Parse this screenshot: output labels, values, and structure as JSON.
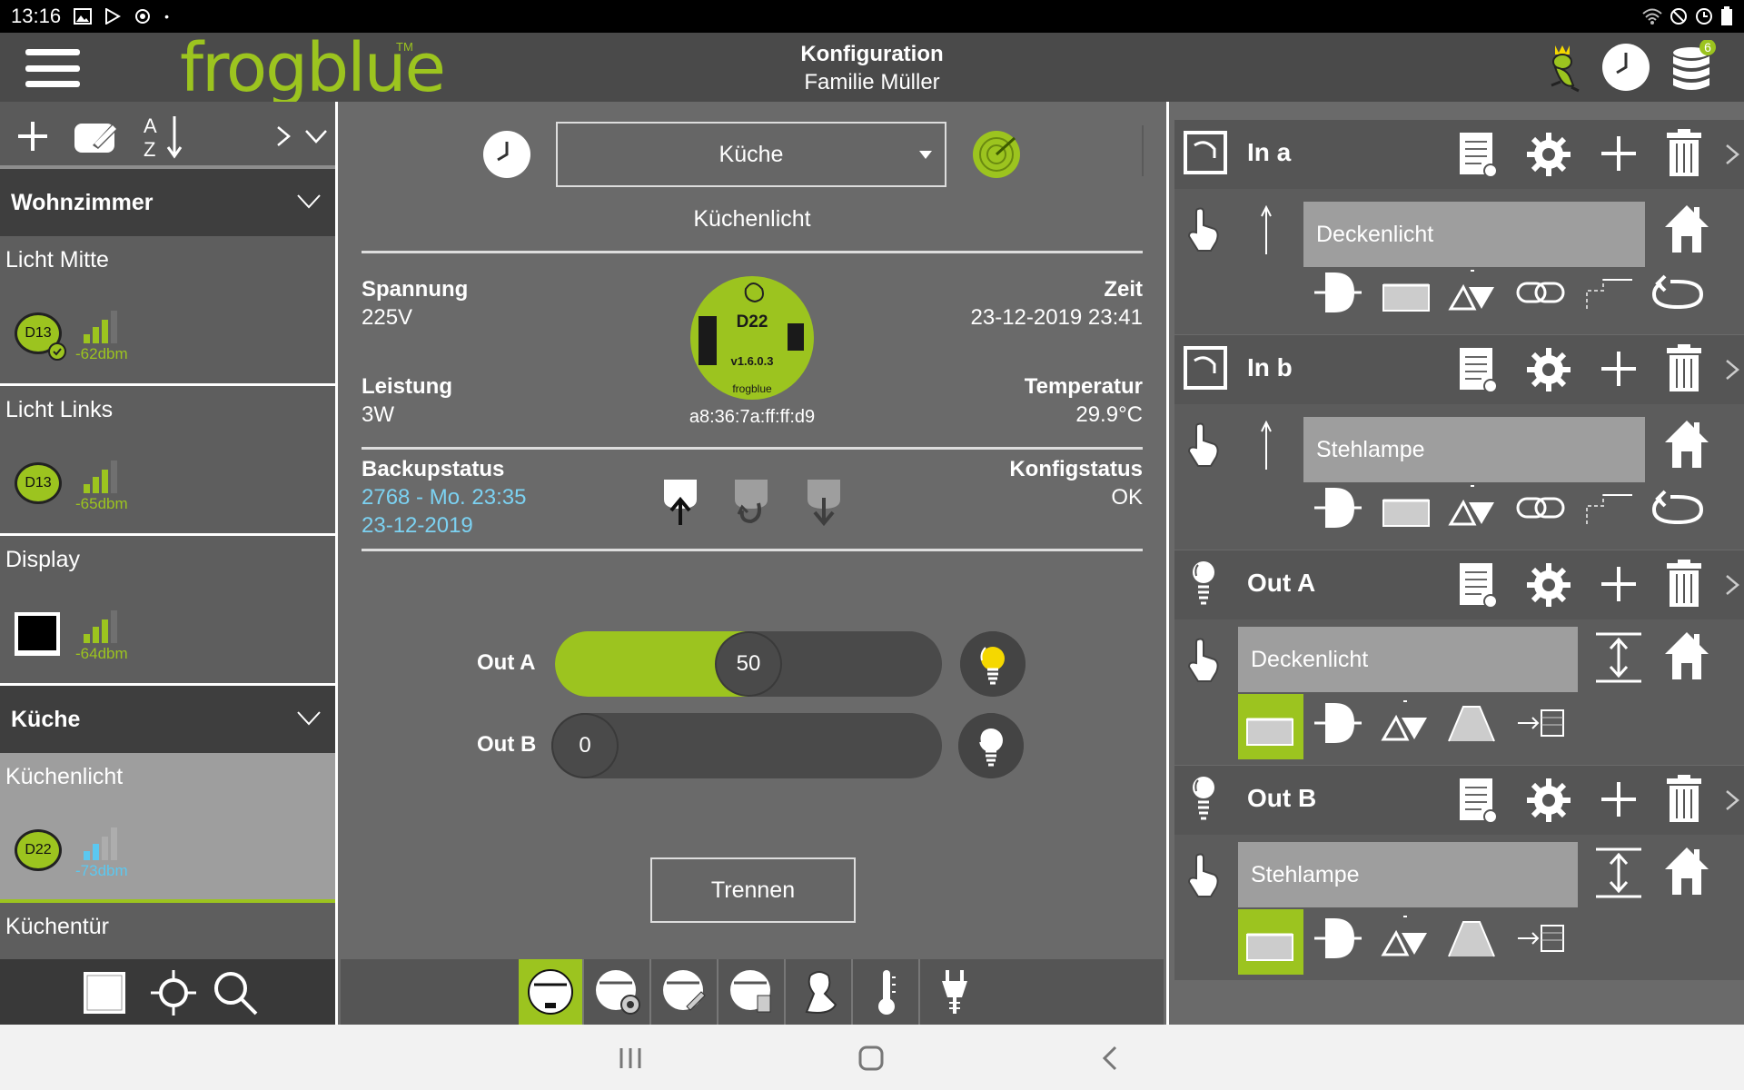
{
  "status_bar": {
    "time": "13:16"
  },
  "header": {
    "logo_text": "frogblue",
    "logo_tm": "TM",
    "title": "Konfiguration",
    "subtitle": "Familie Müller",
    "db_badge": "6",
    "accent": "#9cc41f"
  },
  "left_panel": {
    "rooms": [
      {
        "name": "Wohnzimmer",
        "devices": [
          {
            "name": "Licht Mitte",
            "type": "D13",
            "dbm": "-62dbm",
            "signal_bars": 3
          },
          {
            "name": "Licht Links",
            "type": "D13",
            "dbm": "-65dbm",
            "signal_bars": 3
          },
          {
            "name": "Display",
            "type": "display",
            "dbm": "-64dbm",
            "signal_bars": 3
          }
        ]
      },
      {
        "name": "Küche",
        "devices": [
          {
            "name": "Küchenlicht",
            "type": "D22",
            "dbm": "-73dbm",
            "signal_bars": 2,
            "selected": true
          },
          {
            "name": "Küchentür"
          }
        ]
      }
    ]
  },
  "center": {
    "room_select": "Küche",
    "device_title": "Küchenlicht",
    "spannung_label": "Spannung",
    "spannung_value": "225V",
    "zeit_label": "Zeit",
    "zeit_value": "23-12-2019 23:41",
    "leistung_label": "Leistung",
    "leistung_value": "3W",
    "temperatur_label": "Temperatur",
    "temperatur_value": "29.9°C",
    "chip_model": "D22",
    "chip_version": "v1.6.0.3",
    "chip_brand": "frogblue",
    "mac": "a8:36:7a:ff:ff:d9",
    "backup_label": "Backupstatus",
    "backup_value_1": "2768 - Mo. 23:35",
    "backup_value_2": "23-12-2019",
    "konfig_label": "Konfigstatus",
    "konfig_value": "OK",
    "outputs": [
      {
        "label": "Out A",
        "value": "50",
        "level": 0.5
      },
      {
        "label": "Out B",
        "value": "0",
        "level": 0
      }
    ],
    "disconnect_label": "Trennen"
  },
  "right_panel": {
    "sections": [
      {
        "kind": "input",
        "title": "In a",
        "target": "Deckenlicht"
      },
      {
        "kind": "input",
        "title": "In b",
        "target": "Stehlampe"
      },
      {
        "kind": "output",
        "title": "Out A",
        "target": "Deckenlicht"
      },
      {
        "kind": "output",
        "title": "Out B",
        "target": "Stehlampe"
      }
    ]
  }
}
